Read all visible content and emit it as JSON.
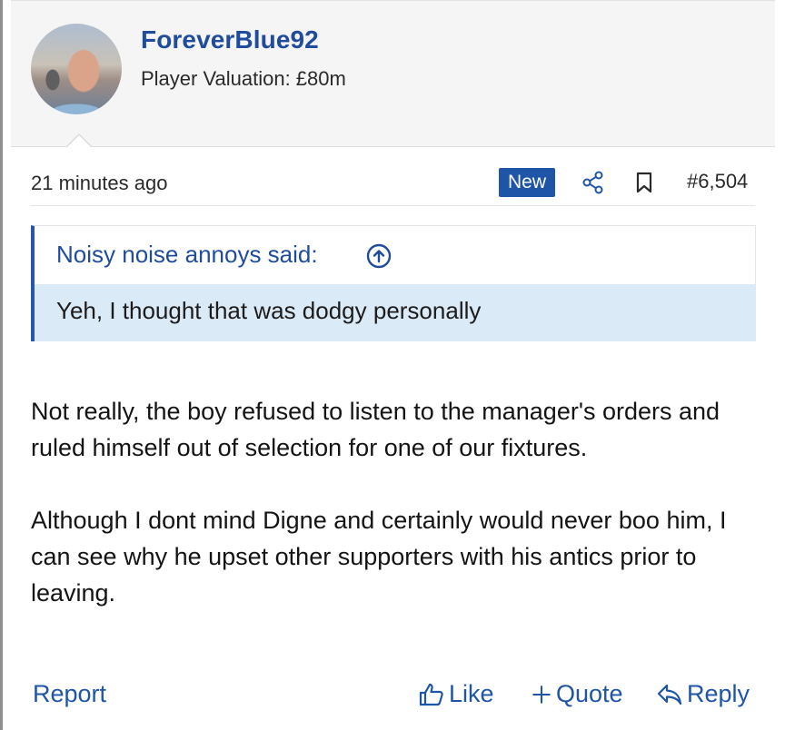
{
  "user": {
    "name": "ForeverBlue92",
    "title": "Player Valuation: £80m"
  },
  "meta": {
    "timestamp": "21 minutes ago",
    "badge": "New",
    "post_number": "#6,504"
  },
  "quote": {
    "author_said": "Noisy noise annoys said:",
    "text": "Yeh, I thought that was dodgy personally"
  },
  "message": {
    "paragraphs": [
      "Not really, the boy refused to listen to the manager's orders and ruled himself out of selection for one of our fixtures.",
      "Although I dont mind Digne and certainly would never boo him, I can see why he upset other supporters with his antics prior to leaving."
    ]
  },
  "actions": {
    "report": "Report",
    "like": "Like",
    "quote": "Quote",
    "reply": "Reply"
  },
  "colors": {
    "link_blue": "#1f55a6",
    "username_blue": "#1f4c9c",
    "quote_bg": "#dbeaf7"
  },
  "icons": [
    "share-icon",
    "bookmark-icon",
    "jump-to-quote-icon",
    "thumbs-up-icon",
    "plus-icon",
    "reply-arrow-icon"
  ]
}
